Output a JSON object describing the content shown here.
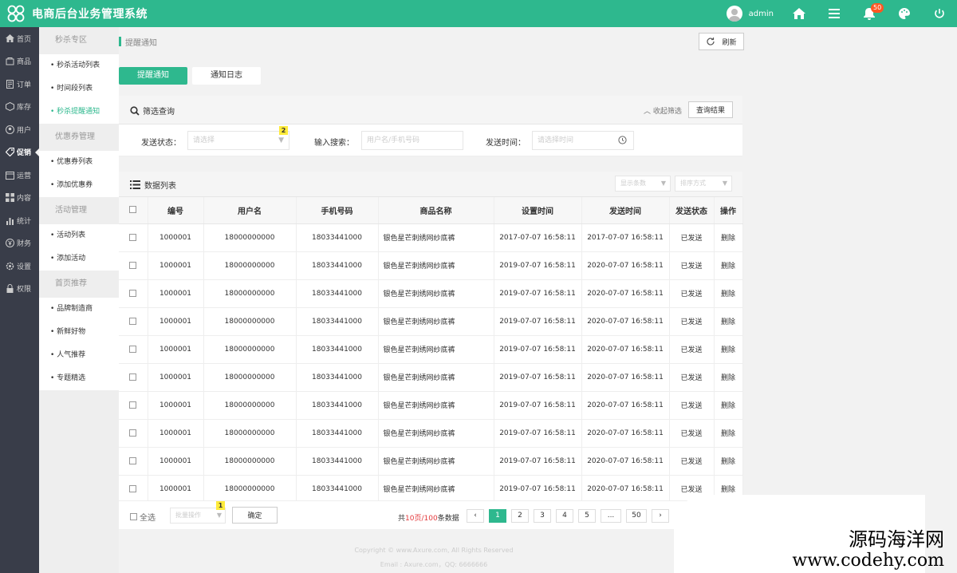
{
  "header": {
    "app_title": "电商后台业务管理系统",
    "username": "admin",
    "notification_count": "50",
    "icons": [
      "home-icon",
      "menu-icon",
      "bell-icon",
      "palette-icon",
      "power-icon"
    ]
  },
  "leftnav": {
    "items": [
      {
        "label": "首页",
        "icon": "home-icon"
      },
      {
        "label": "商品",
        "icon": "goods-icon"
      },
      {
        "label": "订单",
        "icon": "order-icon"
      },
      {
        "label": "库存",
        "icon": "box-icon"
      },
      {
        "label": "用户",
        "icon": "user-icon"
      },
      {
        "label": "促销",
        "icon": "tag-icon"
      },
      {
        "label": "运营",
        "icon": "calendar-icon"
      },
      {
        "label": "内容",
        "icon": "grid-icon"
      },
      {
        "label": "统计",
        "icon": "chart-icon"
      },
      {
        "label": "财务",
        "icon": "money-icon"
      },
      {
        "label": "设置",
        "icon": "gear-icon"
      },
      {
        "label": "权限",
        "icon": "lock-icon"
      }
    ],
    "active_index": 5
  },
  "subnav": {
    "groups": [
      {
        "title": "秒杀专区",
        "items": [
          "秒杀活动列表",
          "时间段列表",
          "秒杀提醒通知"
        ]
      },
      {
        "title": "优惠券管理",
        "items": [
          "优惠券列表",
          "添加优惠券"
        ]
      },
      {
        "title": "活动管理",
        "items": [
          "活动列表",
          "添加活动"
        ]
      },
      {
        "title": "首页推荐",
        "items": [
          "品牌制造商",
          "新鲜好物",
          "人气推荐",
          "专题精选"
        ]
      }
    ],
    "active_item": "秒杀提醒通知"
  },
  "breadcrumb": "提醒通知",
  "refresh_label": "刷新",
  "tabs": [
    "提醒通知",
    "通知日志"
  ],
  "filter": {
    "title": "筛选查询",
    "collapse_label": "收起筛选",
    "query_button": "查询结果",
    "status_label": "发送状态：",
    "status_placeholder": "请选择",
    "search_label": "输入搜索：",
    "search_placeholder": "用户名/手机号码",
    "time_label": "发送时间：",
    "time_placeholder": "请选择时间",
    "hint_badge": "2"
  },
  "list": {
    "title": "数据列表",
    "display_select": "显示条数",
    "sort_select": "排序方式",
    "columns": [
      "编号",
      "用户名",
      "手机号码",
      "商品名称",
      "设置时间",
      "发送时间",
      "发送状态",
      "操作"
    ],
    "rows": [
      [
        "1000001",
        "18000000000",
        "18033441000",
        "银色星芒刺绣网纱底裤",
        "2017-07-07 16:58:11",
        "2017-07-07 16:58:11",
        "已发送",
        "删除"
      ],
      [
        "1000001",
        "18000000000",
        "18033441000",
        "银色星芒刺绣网纱底裤",
        "2019-07-07 16:58:11",
        "2020-07-07 16:58:11",
        "已发送",
        "删除"
      ],
      [
        "1000001",
        "18000000000",
        "18033441000",
        "银色星芒刺绣网纱底裤",
        "2019-07-07 16:58:11",
        "2020-07-07 16:58:11",
        "已发送",
        "删除"
      ],
      [
        "1000001",
        "18000000000",
        "18033441000",
        "银色星芒刺绣网纱底裤",
        "2019-07-07 16:58:11",
        "2020-07-07 16:58:11",
        "已发送",
        "删除"
      ],
      [
        "1000001",
        "18000000000",
        "18033441000",
        "银色星芒刺绣网纱底裤",
        "2019-07-07 16:58:11",
        "2020-07-07 16:58:11",
        "已发送",
        "删除"
      ],
      [
        "1000001",
        "18000000000",
        "18033441000",
        "银色星芒刺绣网纱底裤",
        "2019-07-07 16:58:11",
        "2020-07-07 16:58:11",
        "已发送",
        "删除"
      ],
      [
        "1000001",
        "18000000000",
        "18033441000",
        "银色星芒刺绣网纱底裤",
        "2019-07-07 16:58:11",
        "2020-07-07 16:58:11",
        "已发送",
        "删除"
      ],
      [
        "1000001",
        "18000000000",
        "18033441000",
        "银色星芒刺绣网纱底裤",
        "2019-07-07 16:58:11",
        "2020-07-07 16:58:11",
        "已发送",
        "删除"
      ],
      [
        "1000001",
        "18000000000",
        "18033441000",
        "银色星芒刺绣网纱底裤",
        "2019-07-07 16:58:11",
        "2020-07-07 16:58:11",
        "已发送",
        "删除"
      ],
      [
        "1000001",
        "18000000000",
        "18033441000",
        "银色星芒刺绣网纱底裤",
        "2019-07-07 16:58:11",
        "2020-07-07 16:58:11",
        "已发送",
        "删除"
      ]
    ]
  },
  "footer": {
    "select_all": "全选",
    "batch_placeholder": "批量操作",
    "confirm_button": "确定",
    "hint_badge": "1",
    "page_info_prefix": "共",
    "page_info_pages": "10页/100",
    "page_info_suffix": "条数据",
    "pages": [
      "‹",
      "1",
      "2",
      "3",
      "4",
      "5",
      "...",
      "50",
      "›"
    ],
    "active_page": "1"
  },
  "copyright": {
    "line1": "Copyright © www.Axure.com, All Rights Reserved",
    "line2": "Email : Axure.com，QQ: 6666666"
  },
  "watermark": {
    "line1": "源码海洋网",
    "line2": "www.codehy.com"
  },
  "colors": {
    "accent": "#2eb88e",
    "sidebar": "#393d49",
    "badge": "#ff5722"
  }
}
